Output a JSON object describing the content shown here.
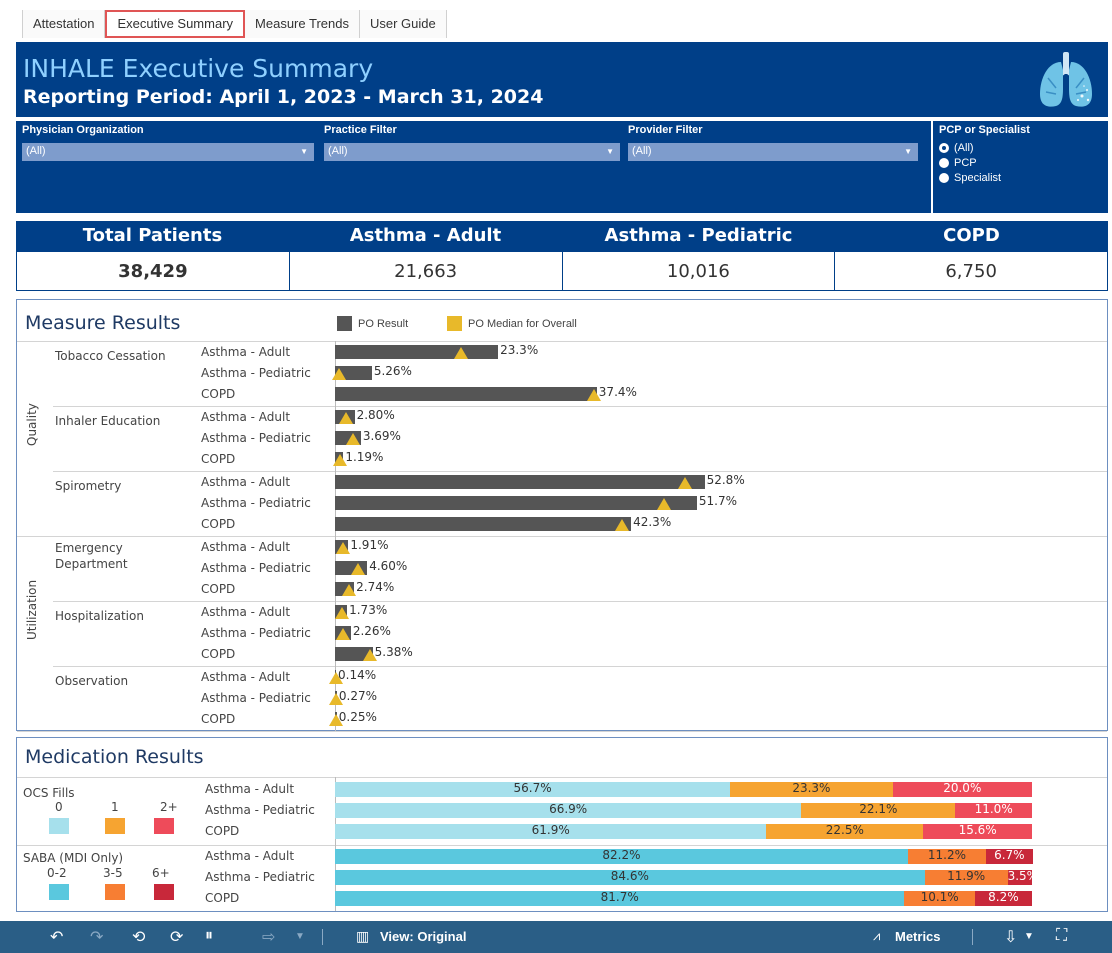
{
  "tabs": [
    "Attestation",
    "Executive Summary",
    "Measure Trends",
    "User Guide"
  ],
  "header": {
    "title": "INHALE Executive Summary",
    "subtitle": "Reporting Period: April 1, 2023 - March 31, 2024"
  },
  "filters": {
    "physician_org": {
      "label": "Physician Organization",
      "value": "(All)"
    },
    "practice": {
      "label": "Practice Filter",
      "value": "(All)"
    },
    "provider": {
      "label": "Provider Filter",
      "value": "(All)"
    },
    "pcp": {
      "label": "PCP or Specialist",
      "options": [
        "(All)",
        "PCP",
        "Specialist"
      ],
      "selected": "(All)"
    }
  },
  "kpis": [
    {
      "label": "Total Patients",
      "value": "38,429"
    },
    {
      "label": "Asthma - Adult",
      "value": "21,663"
    },
    {
      "label": "Asthma - Pediatric",
      "value": "10,016"
    },
    {
      "label": "COPD",
      "value": "6,750"
    }
  ],
  "measure": {
    "title": "Measure Results",
    "legend_result": "PO Result",
    "legend_median": "PO Median for Overall",
    "group_quality": "Quality",
    "group_utilization": "Utilization",
    "sub_names": [
      "Tobacco Cessation",
      "Inhaler Education",
      "Spirometry",
      "Emergency\nDepartment",
      "Hospitalization",
      "Observation"
    ],
    "sub_emergency_1": "Emergency",
    "sub_emergency_2": "Department",
    "row_labels": [
      "Asthma - Adult",
      "Asthma - Pediatric",
      "COPD"
    ]
  },
  "medication": {
    "title": "Medication Results",
    "ocs_label": "OCS Fills",
    "ocs_keys": [
      "0",
      "1",
      "2+"
    ],
    "saba_label": "SABA (MDI Only)",
    "saba_keys": [
      "0-2",
      "3-5",
      "6+"
    ],
    "row_labels": [
      "Asthma - Adult",
      "Asthma - Pediatric",
      "COPD"
    ],
    "ocs_rows": [
      [
        "56.7%",
        "23.3%",
        "20.0%"
      ],
      [
        "66.9%",
        "22.1%",
        "11.0%"
      ],
      [
        "61.9%",
        "22.5%",
        "15.6%"
      ]
    ],
    "saba_rows": [
      [
        "82.2%",
        "11.2%",
        "6.7%"
      ],
      [
        "84.6%",
        "11.9%",
        "3.5%"
      ],
      [
        "81.7%",
        "10.1%",
        "8.2%"
      ]
    ]
  },
  "toolbar": {
    "view_label": "View: Original",
    "metrics_label": "Metrics"
  },
  "colors": {
    "navy": "#003f88",
    "bar": "#555555",
    "median": "#e8b92a",
    "ocs": [
      "#a6e0ec",
      "#f6a431",
      "#ee4b5a"
    ],
    "saba": [
      "#5ac8de",
      "#f77e33",
      "#c8283a"
    ]
  },
  "chart_data": {
    "type": "bar",
    "categories": [
      "Tobacco Cessation | Asthma - Adult",
      "Tobacco Cessation | Asthma - Pediatric",
      "Tobacco Cessation | COPD",
      "Inhaler Education | Asthma - Adult",
      "Inhaler Education | Asthma - Pediatric",
      "Inhaler Education | COPD",
      "Spirometry | Asthma - Adult",
      "Spirometry | Asthma - Pediatric",
      "Spirometry | COPD",
      "Emergency Department | Asthma - Adult",
      "Emergency Department | Asthma - Pediatric",
      "Emergency Department | COPD",
      "Hospitalization | Asthma - Adult",
      "Hospitalization | Asthma - Pediatric",
      "Hospitalization | COPD",
      "Observation | Asthma - Adult",
      "Observation | Asthma - Pediatric",
      "Observation | COPD"
    ],
    "series": [
      {
        "name": "PO Result",
        "values": [
          23.3,
          5.26,
          37.4,
          2.8,
          3.69,
          1.19,
          52.8,
          51.7,
          42.3,
          1.91,
          4.6,
          2.74,
          1.73,
          2.26,
          5.38,
          0.14,
          0.27,
          0.25
        ]
      },
      {
        "name": "PO Median for Overall",
        "values": [
          18.0,
          0.5,
          37.0,
          1.5,
          2.5,
          0.7,
          50.0,
          47.0,
          41.0,
          1.2,
          3.3,
          2.0,
          1.0,
          1.1,
          5.0,
          0.1,
          0.1,
          0.1
        ]
      }
    ],
    "labels": [
      "23.3%",
      "5.26%",
      "37.4%",
      "2.80%",
      "3.69%",
      "1.19%",
      "52.8%",
      "51.7%",
      "42.3%",
      "1.91%",
      "4.60%",
      "2.74%",
      "1.73%",
      "2.26%",
      "5.38%",
      "0.14%",
      "0.27%",
      "0.25%"
    ],
    "xlim": [
      0,
      60
    ]
  }
}
